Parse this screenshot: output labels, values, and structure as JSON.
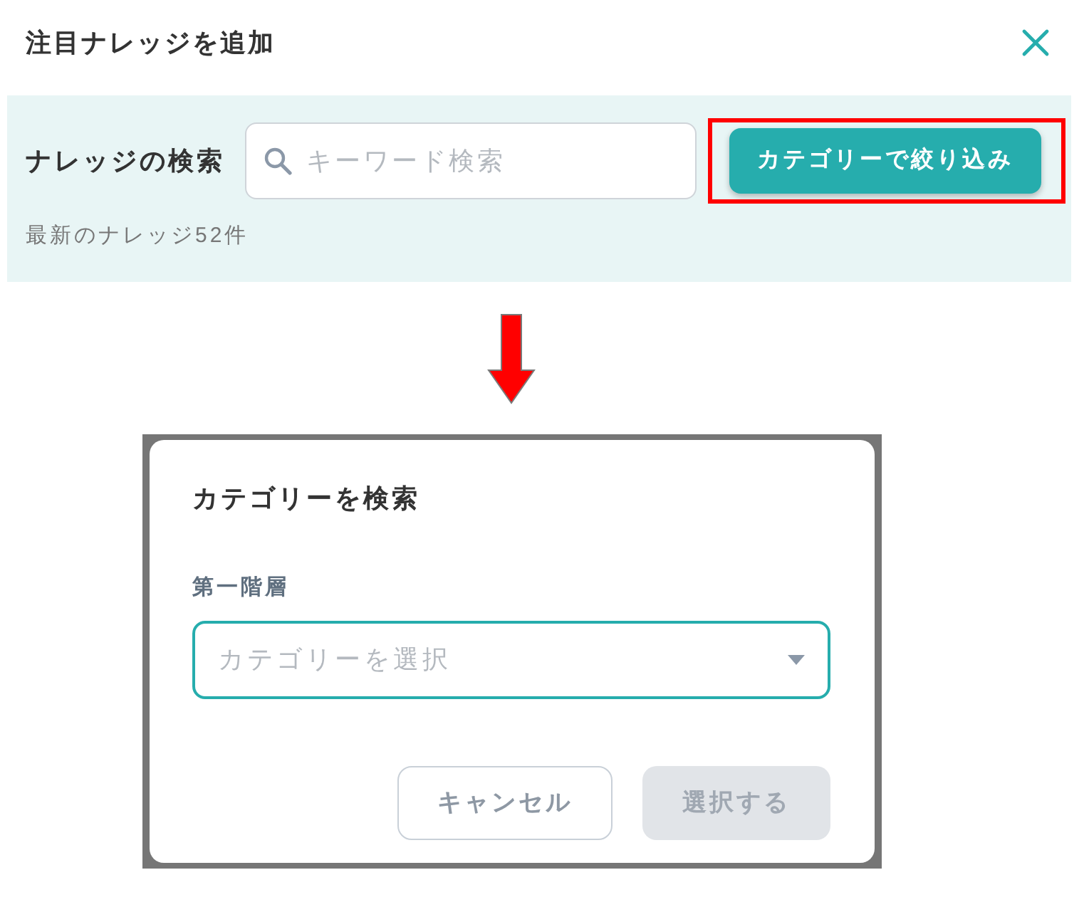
{
  "header": {
    "title": "注目ナレッジを追加"
  },
  "search_panel": {
    "label": "ナレッジの検索",
    "search": {
      "placeholder": "キーワード検索"
    },
    "filter_button": {
      "label": "カテゴリーで絞り込み",
      "highlighted": true
    },
    "count": "最新のナレッジ52件"
  },
  "dialog": {
    "title": "カテゴリーを検索",
    "field": {
      "label": "第一階層",
      "placeholder": "カテゴリーを選択"
    },
    "buttons": [
      {
        "label": "キャンセル",
        "kind": "secondary",
        "disabled": false
      },
      {
        "label": "選択する",
        "kind": "primary",
        "disabled": true
      }
    ]
  }
}
